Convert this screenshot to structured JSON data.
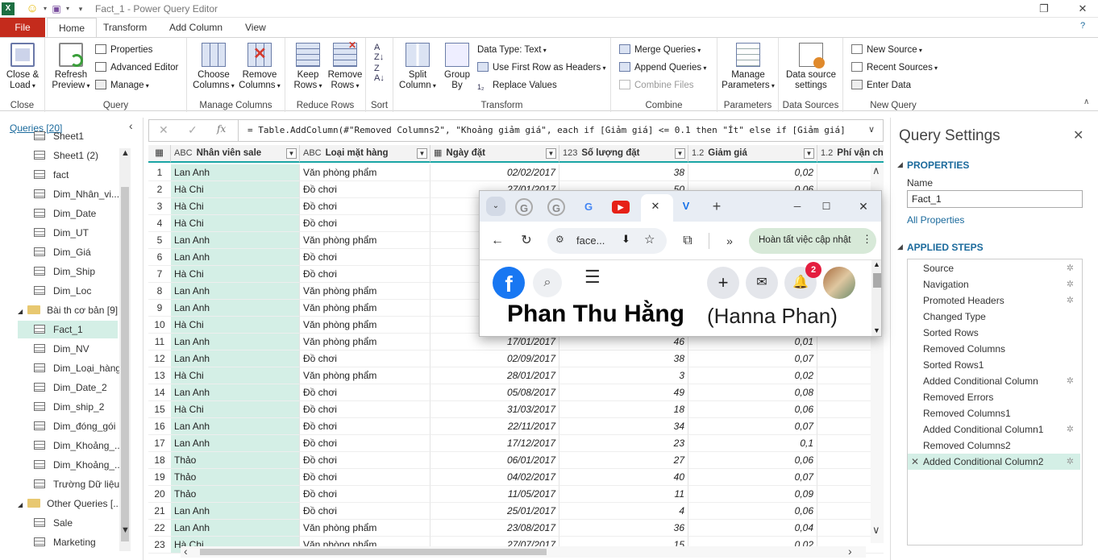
{
  "window": {
    "title": "Fact_1 - Power Query Editor",
    "min": "─",
    "restore": "❐",
    "close": "✕"
  },
  "tabs": [
    "File",
    "Home",
    "Transform",
    "Add Column",
    "View"
  ],
  "ribbon": {
    "close_load": "Close &\nLoad",
    "refresh_preview": "Refresh\nPreview",
    "properties": "Properties",
    "advanced_editor": "Advanced Editor",
    "manage": "Manage",
    "choose_columns": "Choose\nColumns",
    "remove_columns": "Remove\nColumns",
    "keep_rows": "Keep\nRows",
    "remove_rows": "Remove\nRows",
    "split_column": "Split\nColumn",
    "group_by": "Group\nBy",
    "data_type": "Data Type: Text",
    "use_first_row": "Use First Row as Headers",
    "replace_values": "Replace Values",
    "merge_queries": "Merge Queries",
    "append_queries": "Append Queries",
    "combine_files": "Combine Files",
    "manage_parameters": "Manage\nParameters",
    "data_source_settings": "Data source\nsettings",
    "new_source": "New Source",
    "recent_sources": "Recent Sources",
    "enter_data": "Enter Data",
    "groups": [
      "Close",
      "Query",
      "Manage Columns",
      "Reduce Rows",
      "Sort",
      "Transform",
      "Combine",
      "Parameters",
      "Data Sources",
      "New Query"
    ]
  },
  "formula_bar": {
    "fx": "fx",
    "formula": "= Table.AddColumn(#\"Removed Columns2\", \"Khoảng giảm giá\", each if [Giảm giá] <= 0.1 then \"Ít\" else if [Giảm giá]"
  },
  "queries": {
    "header": "Queries [20]",
    "items": [
      "Sheet1",
      "Sheet1 (2)",
      "fact",
      "Dim_Nhân_vi...",
      "Dim_Date",
      "Dim_UT",
      "Dim_Giá",
      "Dim_Ship",
      "Dim_Loc"
    ],
    "folder1": "Bài th cơ bản [9]",
    "folder1_items": [
      "Fact_1",
      "Dim_NV",
      "Dim_Loại_hàng",
      "Dim_Date_2",
      "Dim_ship_2",
      "Dim_đóng_gói",
      "Dim_Khoảng_...",
      "Dim_Khoảng_...",
      "Trường Dữ liệu"
    ],
    "folder2": "Other Queries [...",
    "folder2_items": [
      "Sale",
      "Marketing"
    ]
  },
  "grid": {
    "headers": [
      {
        "type": "ABC",
        "name": "Nhân viên sale"
      },
      {
        "type": "ABC",
        "name": "Loại mặt hàng"
      },
      {
        "type": "date",
        "name": "Ngày đặt"
      },
      {
        "type": "123",
        "name": "Số lượng đặt"
      },
      {
        "type": "1.2",
        "name": "Giảm giá"
      },
      {
        "type": "1.2",
        "name": "Phí vận chu"
      }
    ],
    "rows": [
      [
        "1",
        "Lan Anh",
        "Văn phòng phẩm",
        "02/02/2017",
        "38",
        "0,02"
      ],
      [
        "2",
        "Hà Chi",
        "Đồ chơi",
        "27/01/2017",
        "50",
        "0,06"
      ],
      [
        "3",
        "Hà Chi",
        "Đồ chơi",
        "",
        "",
        ""
      ],
      [
        "4",
        "Hà Chi",
        "Đồ chơi",
        "",
        "",
        ""
      ],
      [
        "5",
        "Lan Anh",
        "Văn phòng phẩm",
        "",
        "",
        ""
      ],
      [
        "6",
        "Lan Anh",
        "Đồ chơi",
        "",
        "",
        ""
      ],
      [
        "7",
        "Hà Chi",
        "Đồ chơi",
        "",
        "",
        ""
      ],
      [
        "8",
        "Lan Anh",
        "Văn phòng phẩm",
        "",
        "",
        ""
      ],
      [
        "9",
        "Lan Anh",
        "Văn phòng phẩm",
        "",
        "",
        ""
      ],
      [
        "10",
        "Hà Chi",
        "Văn phòng phẩm",
        "",
        "",
        ""
      ],
      [
        "11",
        "Lan Anh",
        "Văn phòng phẩm",
        "17/01/2017",
        "46",
        "0,01"
      ],
      [
        "12",
        "Lan Anh",
        "Đồ chơi",
        "02/09/2017",
        "38",
        "0,07"
      ],
      [
        "13",
        "Hà Chi",
        "Văn phòng phẩm",
        "28/01/2017",
        "3",
        "0,02"
      ],
      [
        "14",
        "Lan Anh",
        "Đồ chơi",
        "05/08/2017",
        "49",
        "0,08"
      ],
      [
        "15",
        "Hà Chi",
        "Đồ chơi",
        "31/03/2017",
        "18",
        "0,06"
      ],
      [
        "16",
        "Lan Anh",
        "Đồ chơi",
        "22/11/2017",
        "34",
        "0,07"
      ],
      [
        "17",
        "Lan Anh",
        "Đồ chơi",
        "17/12/2017",
        "23",
        "0,1"
      ],
      [
        "18",
        "Thảo",
        "Đồ chơi",
        "06/01/2017",
        "27",
        "0,06"
      ],
      [
        "19",
        "Thảo",
        "Đồ chơi",
        "04/02/2017",
        "40",
        "0,07"
      ],
      [
        "20",
        "Thảo",
        "Đồ chơi",
        "11/05/2017",
        "11",
        "0,09"
      ],
      [
        "21",
        "Lan Anh",
        "Đồ chơi",
        "25/01/2017",
        "4",
        "0,06"
      ],
      [
        "22",
        "Lan Anh",
        "Văn phòng phẩm",
        "23/08/2017",
        "36",
        "0,04"
      ],
      [
        "23",
        "Hà Chi",
        "Văn phòng phẩm",
        "27/07/2017",
        "15",
        "0,02"
      ]
    ]
  },
  "settings": {
    "title": "Query Settings",
    "properties": "PROPERTIES",
    "name_label": "Name",
    "name_value": "Fact_1",
    "all_properties": "All Properties",
    "applied_steps": "APPLIED STEPS",
    "steps": [
      {
        "label": "Source",
        "gear": true
      },
      {
        "label": "Navigation",
        "gear": true
      },
      {
        "label": "Promoted Headers",
        "gear": true
      },
      {
        "label": "Changed Type",
        "gear": false
      },
      {
        "label": "Sorted Rows",
        "gear": false
      },
      {
        "label": "Removed Columns",
        "gear": false
      },
      {
        "label": "Sorted Rows1",
        "gear": false
      },
      {
        "label": "Added Conditional Column",
        "gear": true
      },
      {
        "label": "Removed Errors",
        "gear": false
      },
      {
        "label": "Removed Columns1",
        "gear": false
      },
      {
        "label": "Added Conditional Column1",
        "gear": true
      },
      {
        "label": "Removed Columns2",
        "gear": false
      },
      {
        "label": "Added Conditional Column2",
        "gear": true
      }
    ]
  },
  "chrome": {
    "address": "face...",
    "update_label": "Hoàn tất việc cập nhật",
    "notification_count": "2",
    "profile_name": "Phan Thu Hằng",
    "profile_alt": "(Hanna Phan)"
  }
}
